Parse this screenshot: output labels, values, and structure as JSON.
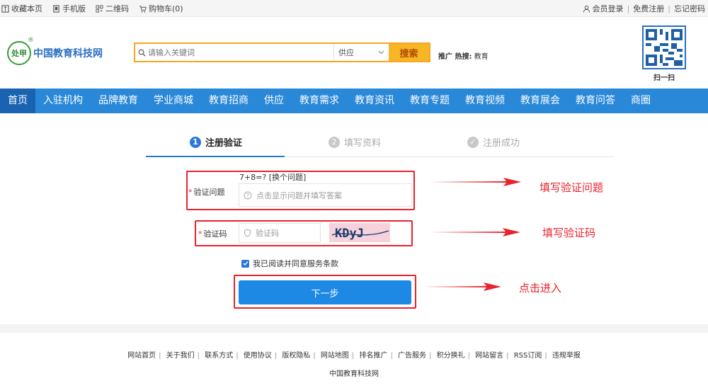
{
  "topbar": {
    "left": [
      {
        "label": "收藏本页",
        "icon": "bookmark-icon"
      },
      {
        "label": "手机版",
        "icon": "mobile-icon"
      },
      {
        "label": "二维码",
        "icon": "qrcode-icon"
      },
      {
        "label": "购物车(0)",
        "icon": "cart-icon"
      }
    ],
    "right": [
      {
        "label": "会员登录",
        "icon": "user-icon"
      },
      {
        "label": "免费注册"
      },
      {
        "label": "忘记密码"
      }
    ]
  },
  "logo": {
    "badge": "处甲",
    "name": "中国教育科技网",
    "reg": "®"
  },
  "search": {
    "placeholder": "请输入关键词",
    "category": "供应",
    "button": "搜索",
    "hot_prefix": "推广 热搜:",
    "hot_terms": "教育"
  },
  "qr": {
    "label": "扫一扫"
  },
  "nav": [
    "首页",
    "入驻机构",
    "品牌教育",
    "学业商城",
    "教育招商",
    "供应",
    "教育需求",
    "教育资讯",
    "教育专题",
    "教育视频",
    "教育展会",
    "教育问答",
    "商圈"
  ],
  "steps": [
    {
      "num": "1",
      "label": "注册验证"
    },
    {
      "num": "2",
      "label": "填写资料"
    },
    {
      "num": "✓",
      "label": "注册成功"
    }
  ],
  "form": {
    "question_label": "验证问题",
    "question_text": "7+8=?  [换个问题]",
    "question_placeholder": "点击显示问题并填写答案",
    "code_label": "验证码",
    "code_placeholder": "验证码",
    "captcha_text": "KDyJ",
    "agree_label": "我已阅读并同意服务条款",
    "agree_checked": true,
    "next_button": "下一步"
  },
  "annotations": {
    "question": "填写验证问题",
    "code": "填写验证码",
    "next": "点击进入",
    "color": "#e8232d"
  },
  "footer": {
    "links": [
      "网站首页",
      "关于我们",
      "联系方式",
      "使用协议",
      "版权隐私",
      "网站地图",
      "排名推广",
      "广告服务",
      "积分换礼",
      "网站留言",
      "RSS订阅",
      "违规举报"
    ],
    "copyright": "中国教育科技网"
  }
}
